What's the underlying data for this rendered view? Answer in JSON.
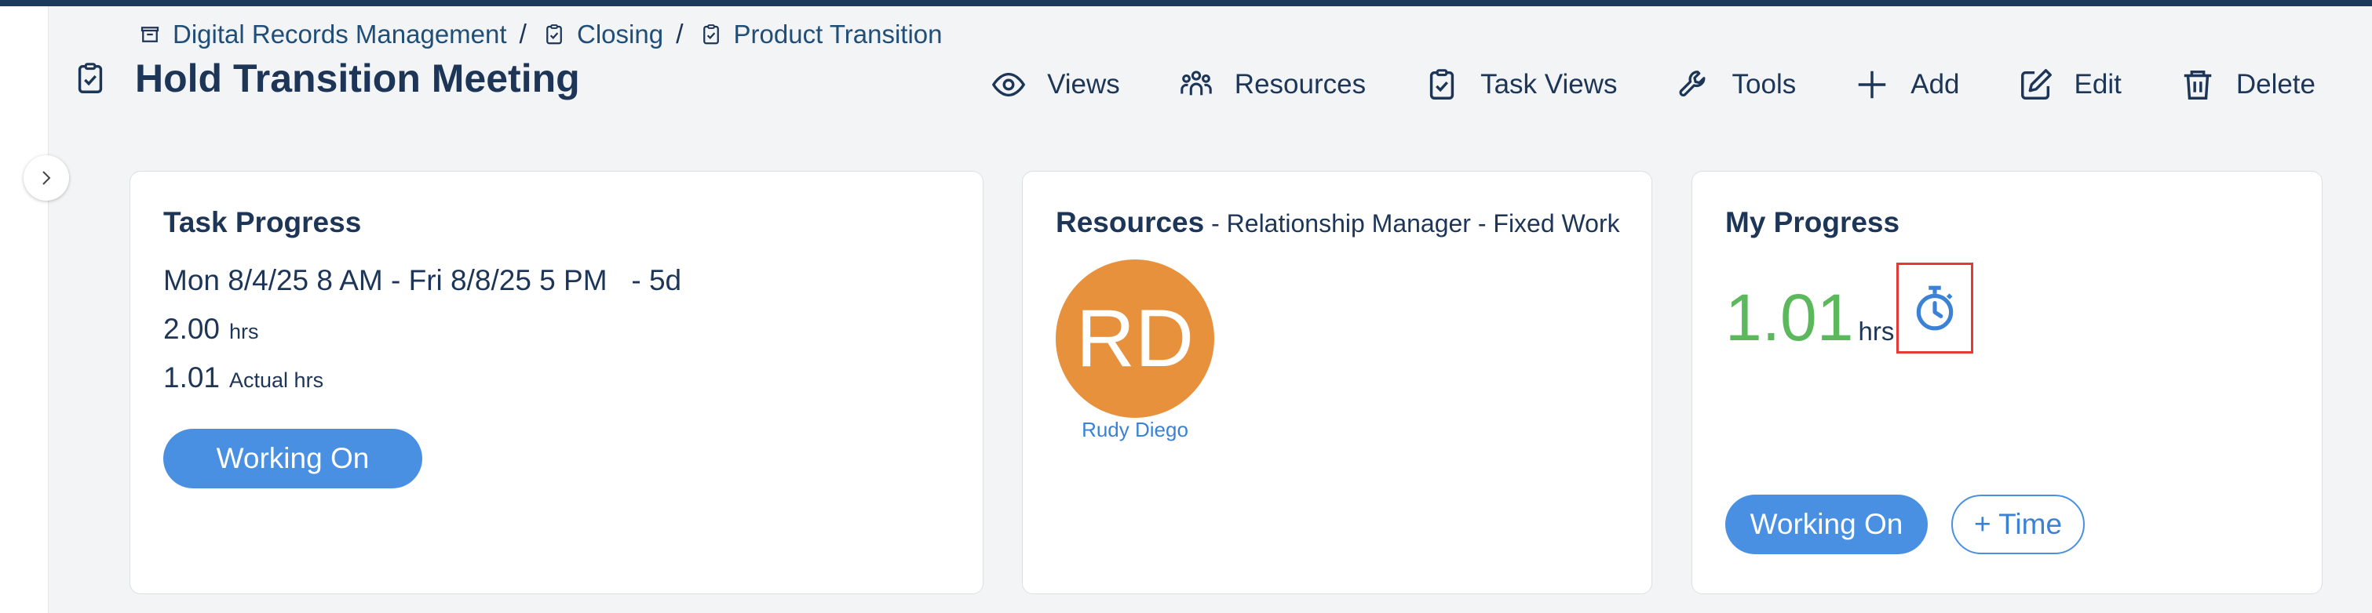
{
  "breadcrumb": {
    "items": [
      {
        "label": "Digital Records Management",
        "icon": "archive-icon"
      },
      {
        "label": "Closing",
        "icon": "clipboard-check-icon"
      },
      {
        "label": "Product Transition",
        "icon": "clipboard-check-icon"
      }
    ],
    "separator": "/"
  },
  "header": {
    "title": "Hold Transition Meeting",
    "icon": "clipboard-check-icon"
  },
  "toolbar": {
    "views": "Views",
    "resources": "Resources",
    "task_views": "Task Views",
    "tools": "Tools",
    "add": "Add",
    "edit": "Edit",
    "delete": "Delete"
  },
  "task_progress": {
    "title": "Task Progress",
    "dates": "Mon 8/4/25 8 AM - Fri 8/8/25 5 PM   - 5d",
    "planned_hours": "2.00",
    "planned_unit": "hrs",
    "actual_hours": "1.01",
    "actual_unit": "Actual hrs",
    "status_button": "Working On"
  },
  "resources": {
    "title": "Resources",
    "subtitle": " - Relationship Manager - Fixed Work",
    "avatar_initials": "RD",
    "avatar_color": "#e8913d",
    "name": "Rudy Diego"
  },
  "my_progress": {
    "title": "My Progress",
    "hours": "1.01",
    "unit": "hrs",
    "status_button": "Working On",
    "add_time_button": "+ Time",
    "hours_color": "#5cb85c",
    "highlight_color": "#e53935"
  },
  "colors": {
    "accent": "#4a90e2",
    "text": "#1d3557",
    "topbar": "#1b3a5c"
  }
}
